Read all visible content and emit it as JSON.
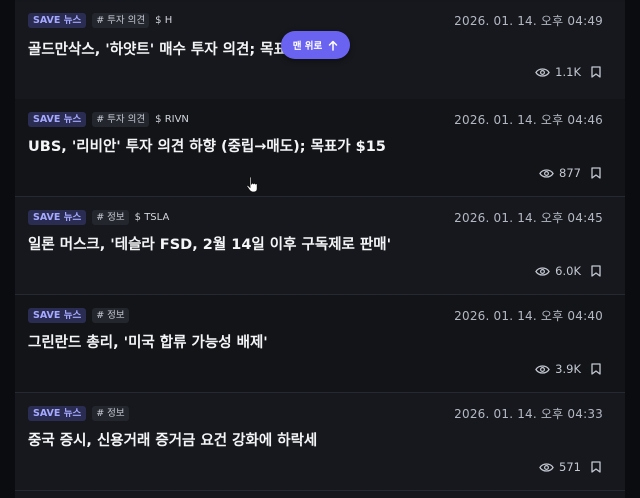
{
  "feed": {
    "items": [
      {
        "badge": "SAVE 뉴스",
        "category": "# 투자 의견",
        "ticker": "$ H",
        "date": "2026. 01. 14. 오후 04:49",
        "title": "골드만삭스, '하얏트' 매수 투자 의견; 목표가",
        "views": "1.1K"
      },
      {
        "badge": "SAVE 뉴스",
        "category": "# 투자 의견",
        "ticker": "$ RIVN",
        "date": "2026. 01. 14. 오후 04:46",
        "title": "UBS, '리비안' 투자 의견 하향 (중립→매도); 목표가 $15",
        "views": "877"
      },
      {
        "badge": "SAVE 뉴스",
        "category": "# 정보",
        "ticker": "$ TSLA",
        "date": "2026. 01. 14. 오후 04:45",
        "title": "일론 머스크, '테슬라 FSD, 2월 14일 이후 구독제로 판매'",
        "views": "6.0K"
      },
      {
        "badge": "SAVE 뉴스",
        "category": "# 정보",
        "ticker": "",
        "date": "2026. 01. 14. 오후 04:40",
        "title": "그린란드 총리, '미국 합류 가능성 배제'",
        "views": "3.9K"
      },
      {
        "badge": "SAVE 뉴스",
        "category": "# 정보",
        "ticker": "",
        "date": "2026. 01. 14. 오후 04:33",
        "title": "중국 증시, 신용거래 증거금 요건 강화에 하락세",
        "views": "571"
      }
    ]
  },
  "scroll_top_button": {
    "label": "맨 위로",
    "icon": "arrow-up-icon"
  },
  "icons": {
    "views": "eye-icon",
    "bookmark": "bookmark-icon",
    "cursor": "pointer-cursor-icon"
  },
  "colors": {
    "accent": "#6a63f2",
    "badge_text": "#a5a9ff",
    "background": "#16181d"
  }
}
